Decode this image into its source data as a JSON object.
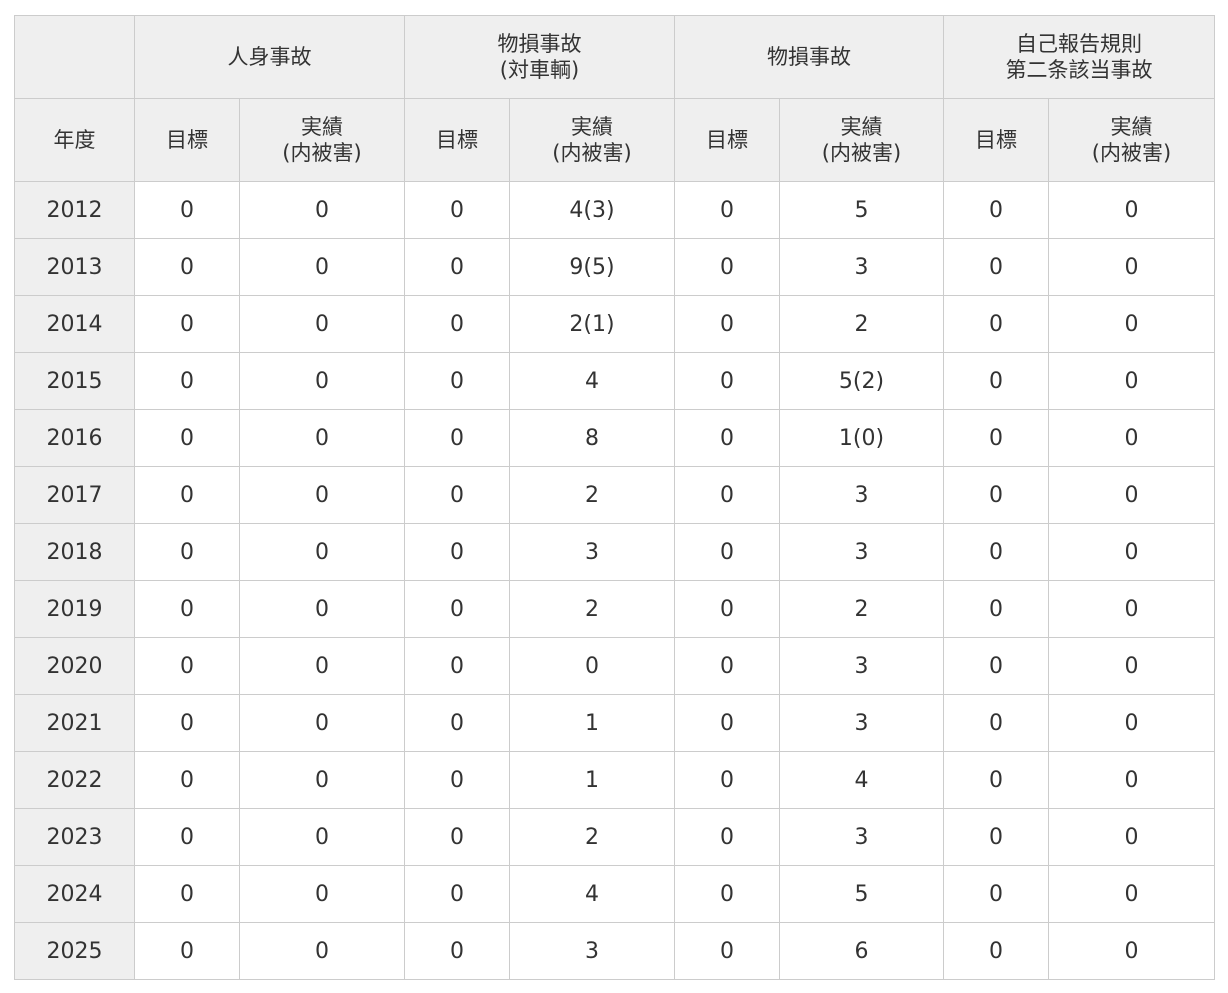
{
  "table": {
    "groups": [
      {
        "lines": [
          "人身事故"
        ]
      },
      {
        "lines": [
          "物損事故",
          "(対車輌)"
        ]
      },
      {
        "lines": [
          "物損事故"
        ]
      },
      {
        "lines": [
          "自己報告規則",
          "第二条該当事故"
        ]
      }
    ],
    "year_header": "年度",
    "target_header": "目標",
    "actual_header_lines": [
      "実績",
      "(内被害)"
    ],
    "rows": [
      {
        "year": "2012",
        "cells": [
          "0",
          "0",
          "0",
          "4(3)",
          "0",
          "5",
          "0",
          "0"
        ]
      },
      {
        "year": "2013",
        "cells": [
          "0",
          "0",
          "0",
          "9(5)",
          "0",
          "3",
          "0",
          "0"
        ]
      },
      {
        "year": "2014",
        "cells": [
          "0",
          "0",
          "0",
          "2(1)",
          "0",
          "2",
          "0",
          "0"
        ]
      },
      {
        "year": "2015",
        "cells": [
          "0",
          "0",
          "0",
          "4",
          "0",
          "5(2)",
          "0",
          "0"
        ]
      },
      {
        "year": "2016",
        "cells": [
          "0",
          "0",
          "0",
          "8",
          "0",
          "1(0)",
          "0",
          "0"
        ]
      },
      {
        "year": "2017",
        "cells": [
          "0",
          "0",
          "0",
          "2",
          "0",
          "3",
          "0",
          "0"
        ]
      },
      {
        "year": "2018",
        "cells": [
          "0",
          "0",
          "0",
          "3",
          "0",
          "3",
          "0",
          "0"
        ]
      },
      {
        "year": "2019",
        "cells": [
          "0",
          "0",
          "0",
          "2",
          "0",
          "2",
          "0",
          "0"
        ]
      },
      {
        "year": "2020",
        "cells": [
          "0",
          "0",
          "0",
          "0",
          "0",
          "3",
          "0",
          "0"
        ]
      },
      {
        "year": "2021",
        "cells": [
          "0",
          "0",
          "0",
          "1",
          "0",
          "3",
          "0",
          "0"
        ]
      },
      {
        "year": "2022",
        "cells": [
          "0",
          "0",
          "0",
          "1",
          "0",
          "4",
          "0",
          "0"
        ]
      },
      {
        "year": "2023",
        "cells": [
          "0",
          "0",
          "0",
          "2",
          "0",
          "3",
          "0",
          "0"
        ]
      },
      {
        "year": "2024",
        "cells": [
          "0",
          "0",
          "0",
          "4",
          "0",
          "5",
          "0",
          "0"
        ]
      },
      {
        "year": "2025",
        "cells": [
          "0",
          "0",
          "0",
          "3",
          "0",
          "6",
          "0",
          "0"
        ]
      }
    ]
  }
}
